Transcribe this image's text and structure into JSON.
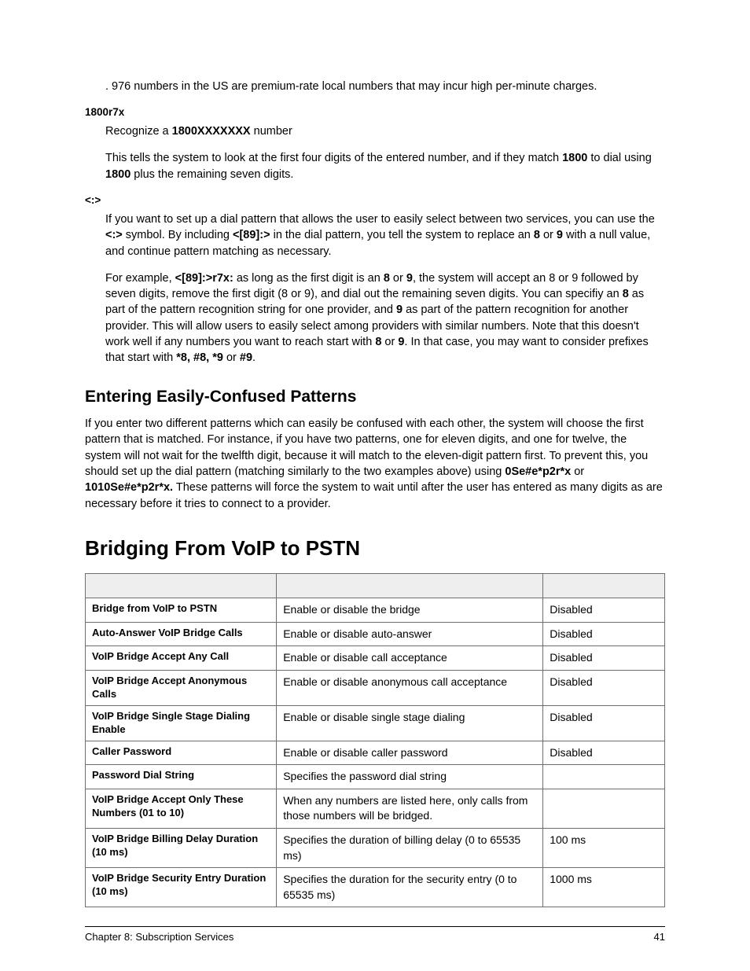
{
  "intro": {
    "line": ". 976 numbers in the US are premium-rate local numbers that may incur high per-minute charges."
  },
  "s1800": {
    "label": "1800r7x",
    "recognize_pre": "Recognize a ",
    "recognize_bold": "1800XXXXXXX",
    "recognize_post": " number",
    "p2a": "This tells the system to look at the first four digits of the entered number, and if they match ",
    "p2b": "1800",
    "p2c": " to dial using ",
    "p2d": "1800",
    "p2e": " plus the remaining seven digits."
  },
  "colon": {
    "label": "<:>",
    "p1a": "If you want to set up a dial pattern that allows the user to easily select between two services, you can use the ",
    "p1b": "<:>",
    "p1c": " symbol. By including ",
    "p1d": "<[89]:>",
    "p1e": " in the dial pattern, you tell the system to replace an ",
    "p1f": "8",
    "p1g": " or ",
    "p1h": "9",
    "p1i": " with a null value, and continue pattern matching as necessary.",
    "p2a": "For example, ",
    "p2b": "<[89]:>r7x:",
    "p2c": " as long as the first digit is an ",
    "p2d": "8",
    "p2e": " or ",
    "p2f": "9",
    "p2g": ", the system will accept an 8 or 9 followed by seven digits, remove the first digit (8 or 9), and dial out the remaining seven digits. You can specifiy an ",
    "p2h": "8",
    "p2i": " as part of the pattern recognition string for one provider, and ",
    "p2j": "9",
    "p2k": " as part of the pattern recognition for another provider. This will allow users to easily select among providers with similar numbers. Note that this doesn't work well if any numbers you want to reach start with ",
    "p2l": "8",
    "p2m": " or ",
    "p2n": "9",
    "p2o": ". In that case, you may want to consider prefixes that start with ",
    "p2p": "*8, #8, *9",
    "p2q": " or ",
    "p2r": "#9",
    "p2s": "."
  },
  "h2": "Entering Easily-Confused Patterns",
  "confused": {
    "a": "If you enter two different patterns which can easily be confused with each other, the system will choose the first pattern that is matched. For instance, if you have two patterns, one for eleven digits, and one for twelve, the system will not wait for the twelfth digit, because it will match to the eleven-digit pattern first. To prevent this, you should set up the dial pattern (matching similarly to the two examples above) using ",
    "b": "0Se#e*p2r*x",
    "c": " or ",
    "d": "1010Se#e*p2r*x.",
    "e": " These patterns will force the system to wait until after the user has entered as many digits as are necessary before it tries to connect to a provider."
  },
  "h1": "Bridging From VoIP to PSTN",
  "table": [
    {
      "name": "Bridge from VoIP to PSTN",
      "desc": "Enable or disable the bridge",
      "def": "Disabled"
    },
    {
      "name": "Auto-Answer VoIP Bridge Calls",
      "desc": "Enable or disable auto-answer",
      "def": "Disabled"
    },
    {
      "name": "VoIP Bridge Accept Any Call",
      "desc": "Enable or disable call acceptance",
      "def": "Disabled"
    },
    {
      "name": "VoIP Bridge Accept Anonymous Calls",
      "desc": "Enable or disable anonymous call acceptance",
      "def": "Disabled"
    },
    {
      "name": "VoIP Bridge Single Stage Dialing Enable",
      "desc": "Enable or disable single stage dialing",
      "def": "Disabled"
    },
    {
      "name": "Caller Password",
      "desc": "Enable or disable caller password",
      "def": "Disabled"
    },
    {
      "name": "Password Dial String",
      "desc": "Specifies the password dial string",
      "def": ""
    },
    {
      "name": "VoIP Bridge Accept Only These Numbers (01 to 10)",
      "desc": "When any numbers are listed here, only calls from those numbers will be bridged.",
      "def": ""
    },
    {
      "name": "VoIP Bridge Billing Delay Duration (10 ms)",
      "desc": "Specifies the duration of billing delay (0 to 65535 ms)",
      "def": "100 ms"
    },
    {
      "name": "VoIP Bridge Security Entry Duration (10 ms)",
      "desc": "Specifies the duration for the security entry (0 to 65535 ms)",
      "def": "1000 ms"
    }
  ],
  "footer": {
    "left": "Chapter 8:  Subscription Services",
    "right": "41"
  }
}
